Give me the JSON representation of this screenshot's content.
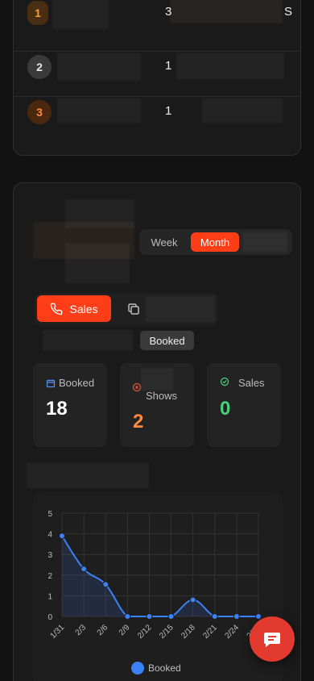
{
  "leaderboard": {
    "rows": [
      {
        "rank": "1",
        "value": "3",
        "trail": "S"
      },
      {
        "rank": "2",
        "value": "1",
        "trail": ""
      },
      {
        "rank": "3",
        "value": "1",
        "trail": ""
      }
    ]
  },
  "period_toggle": {
    "week_label": "Week",
    "month_label": "Month",
    "selected": "Month"
  },
  "type_toggle": {
    "sales_label": "Sales",
    "selected": "Sales"
  },
  "tooltip": {
    "text": "Booked"
  },
  "stats": [
    {
      "label": "Booked",
      "value": "18",
      "icon": "calendar-icon",
      "color": "#ffffff"
    },
    {
      "label": "Shows",
      "value": "2",
      "icon": "x-circle-icon",
      "color": "#ff8a3d"
    },
    {
      "label": "Sales",
      "value": "0",
      "icon": "check-circle-icon",
      "color": "#4ccf7a"
    }
  ],
  "colors": {
    "accent": "#ff3d17",
    "series": "#3b82f6",
    "fab": "#e23a2e"
  },
  "chart_data": {
    "type": "area",
    "x": [
      "1/31",
      "2/3",
      "2/6",
      "2/9",
      "2/12",
      "2/15",
      "2/18",
      "2/21",
      "2/24",
      "2/27"
    ],
    "series": [
      {
        "name": "Booked",
        "values": [
          3.9,
          2.3,
          1.55,
          0,
          0,
          0,
          0.8,
          0,
          0,
          0
        ]
      }
    ],
    "ylim": [
      0,
      5
    ],
    "yticks": [
      "0",
      "1",
      "2",
      "3",
      "4",
      "5"
    ],
    "grid": true,
    "legend": "bottom"
  },
  "chat_fab": {
    "icon": "chat-icon"
  }
}
